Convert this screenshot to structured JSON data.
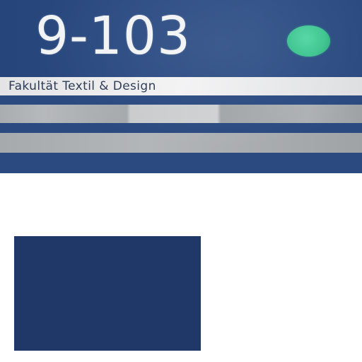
{
  "sign": {
    "room_number": "9-103",
    "department": "Fakultät Textil & Design",
    "status_color": "#3cc48f",
    "background_color": "#2b4b82"
  },
  "swatch": {
    "color": "#1f3868"
  }
}
